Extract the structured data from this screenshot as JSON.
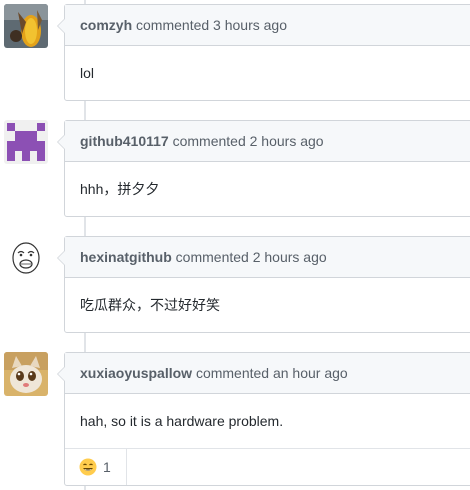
{
  "comments": [
    {
      "author": "comzyh",
      "action": "commented 3 hours ago",
      "body": "lol"
    },
    {
      "author": "github410117",
      "action": "commented 2 hours ago",
      "body": "hhh，拼夕夕"
    },
    {
      "author": "hexinatgithub",
      "action": "commented 2 hours ago",
      "body": "吃瓜群众，不过好好笑"
    },
    {
      "author": "xuxiaoyuspallow",
      "action": "commented an hour ago",
      "body": "hah, so it is a hardware problem.",
      "reaction": {
        "emoji": "laugh-icon",
        "count": "1"
      }
    }
  ],
  "colors": {
    "header_bg": "#f6f8fa",
    "border": "#d1d5da",
    "identicon": "#8c50b4"
  }
}
